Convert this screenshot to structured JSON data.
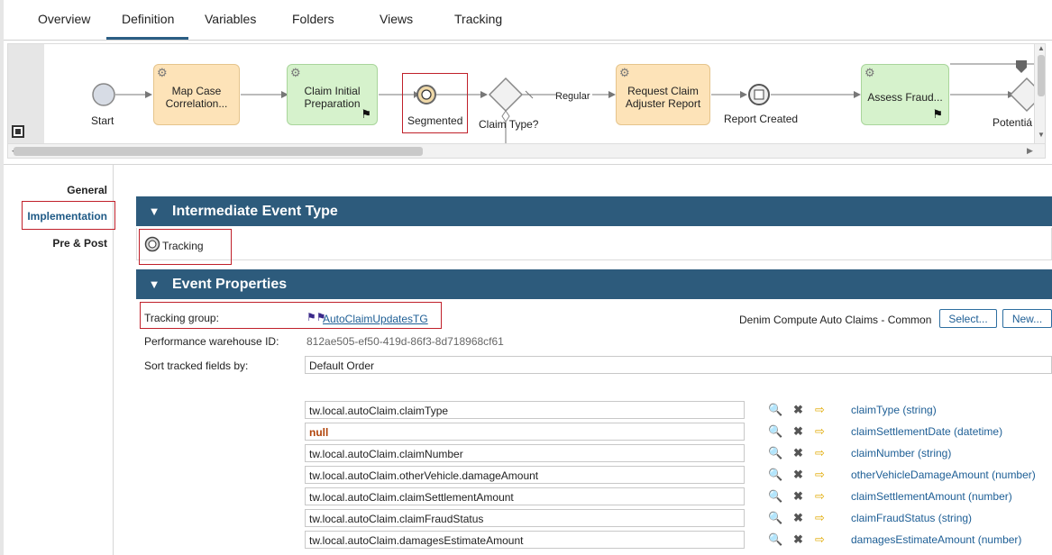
{
  "tabs": [
    {
      "label": "Overview"
    },
    {
      "label": "Definition"
    },
    {
      "label": "Variables"
    },
    {
      "label": "Folders"
    },
    {
      "label": "Views"
    },
    {
      "label": "Tracking"
    }
  ],
  "diagram": {
    "start_label": "Start",
    "map_case": "Map Case Correlation...",
    "claim_initial": "Claim Initial Preparation",
    "segmented": "Segmented",
    "claim_type": "Claim Type?",
    "regular": "Regular",
    "request_claim": "Request Claim Adjuster Report",
    "report_created": "Report Created",
    "assess_fraud": "Assess Fraud...",
    "potential": "Potentiá"
  },
  "sidenav": {
    "general": "General",
    "implementation": "Implementation",
    "pre_post": "Pre & Post"
  },
  "intermediate": {
    "header": "Intermediate Event Type",
    "type": "Tracking"
  },
  "event_props": {
    "header": "Event Properties",
    "tracking_group_label": "Tracking group:",
    "tracking_group_value": "AutoClaimUpdatesTG",
    "perf_label": "Performance warehouse ID:",
    "perf_value": "812ae505-ef50-419d-86f3-8d718968cf61",
    "sort_label": "Sort tracked fields by:",
    "sort_value": "Default Order",
    "library": "Denim Compute Auto Claims - Common",
    "select_btn": "Select...",
    "new_btn": "New..."
  },
  "mappings": [
    {
      "expr": "tw.local.autoClaim.claimType",
      "field": "claimType (string)"
    },
    {
      "expr": "null",
      "field": "claimSettlementDate (datetime)"
    },
    {
      "expr": "tw.local.autoClaim.claimNumber",
      "field": "claimNumber (string)"
    },
    {
      "expr": "tw.local.autoClaim.otherVehicle.damageAmount",
      "field": "otherVehicleDamageAmount (number)"
    },
    {
      "expr": "tw.local.autoClaim.claimSettlementAmount",
      "field": "claimSettlementAmount (number)"
    },
    {
      "expr": "tw.local.autoClaim.claimFraudStatus",
      "field": "claimFraudStatus (string)"
    },
    {
      "expr": "tw.local.autoClaim.damagesEstimateAmount",
      "field": "damagesEstimateAmount (number)"
    }
  ],
  "colors": {
    "header_bg": "#2d5b7c",
    "accent": "#1f5a86",
    "highlight": "#c0202a",
    "task_orange": "#fde3b8",
    "task_green": "#d6f2cc"
  }
}
